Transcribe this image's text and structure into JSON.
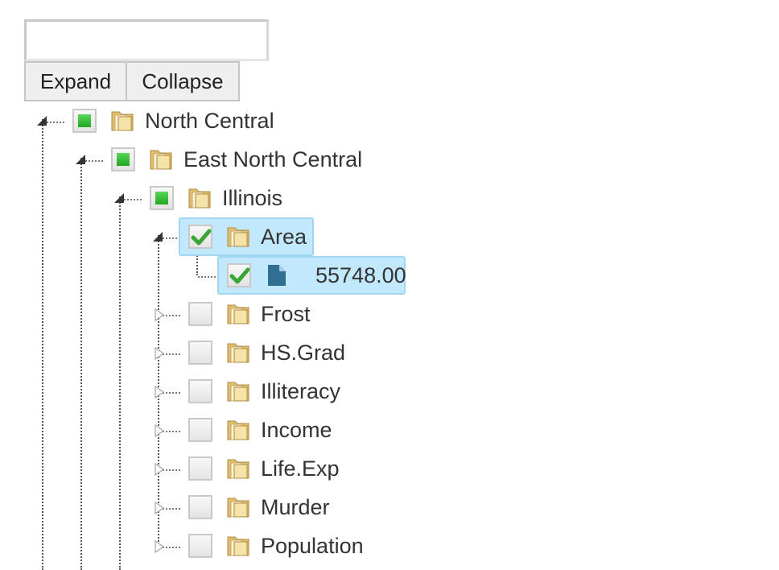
{
  "search": {
    "value": "",
    "placeholder": ""
  },
  "toolbar": {
    "expand_label": "Expand",
    "collapse_label": "Collapse"
  },
  "tree": {
    "north_central": {
      "label": "North Central",
      "state": "partial",
      "icon": "folder-icon",
      "expanded": true
    },
    "east_north_central": {
      "label": "East North Central",
      "state": "partial",
      "icon": "folder-icon",
      "expanded": true
    },
    "illinois": {
      "label": "Illinois",
      "state": "partial",
      "icon": "folder-icon",
      "expanded": true
    },
    "variables": [
      {
        "label": "Area",
        "state": "checked",
        "icon": "folder-icon",
        "expanded": true,
        "selected": true
      },
      {
        "label": "Frost",
        "state": "unchecked",
        "icon": "folder-icon",
        "expanded": false
      },
      {
        "label": "HS.Grad",
        "state": "unchecked",
        "icon": "folder-icon",
        "expanded": false
      },
      {
        "label": "Illiteracy",
        "state": "unchecked",
        "icon": "folder-icon",
        "expanded": false
      },
      {
        "label": "Income",
        "state": "unchecked",
        "icon": "folder-icon",
        "expanded": false
      },
      {
        "label": "Life.Exp",
        "state": "unchecked",
        "icon": "folder-icon",
        "expanded": false
      },
      {
        "label": "Murder",
        "state": "unchecked",
        "icon": "folder-icon",
        "expanded": false
      },
      {
        "label": "Population",
        "state": "unchecked",
        "icon": "folder-icon",
        "expanded": false
      }
    ],
    "area_value": {
      "label": "55748.00",
      "state": "checked",
      "icon": "file-icon",
      "selected": true
    }
  },
  "colors": {
    "selection_bg": "#c2e8fb",
    "selection_border": "#9fd6f2",
    "partial_fill": "#2cb52c",
    "check_mark": "#3aa63a",
    "file_icon": "#2f6f93"
  }
}
